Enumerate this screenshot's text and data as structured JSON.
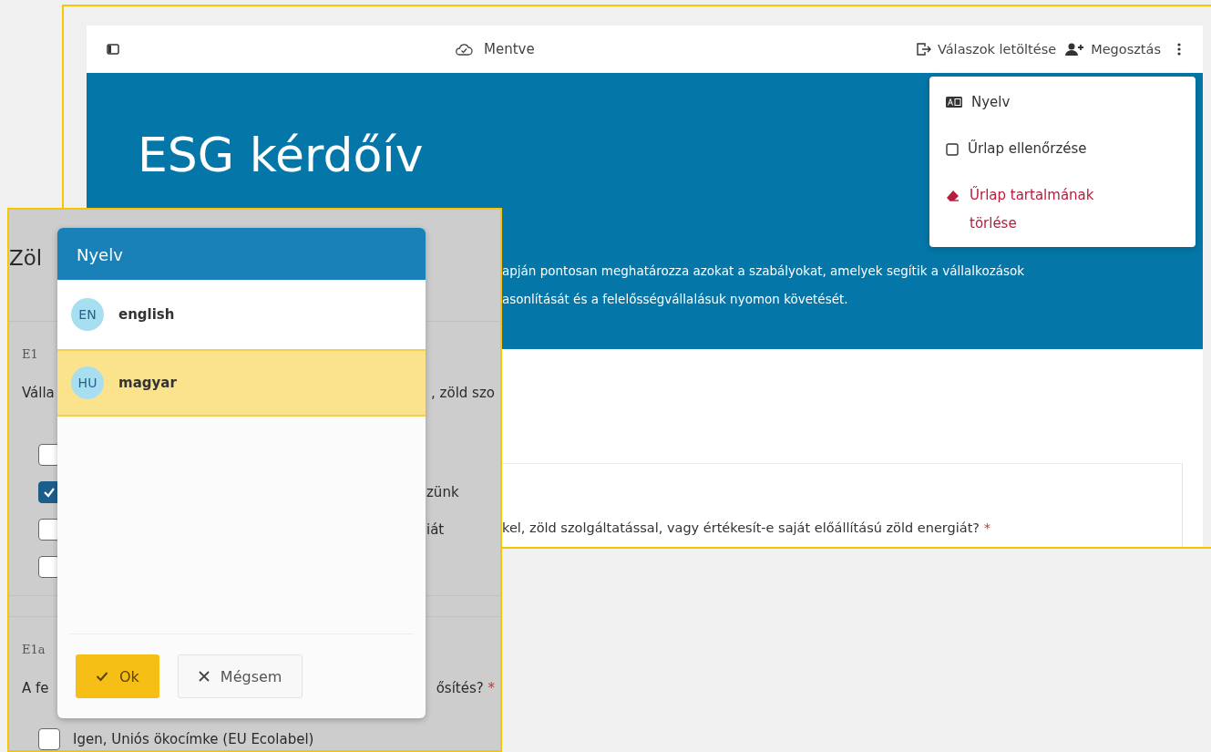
{
  "top_bar": {
    "saved_status": "Mentve",
    "download_button": "Válaszok letöltése",
    "share_button": "Megosztás"
  },
  "header": {
    "title": "ESG kérdőív",
    "description_lines": [
      "apján pontosan meghatározza azokat a szabályokat, amelyek segítik a vállalkozások",
      "asonlítását és a felelősségvállalásuk nyomon követését."
    ]
  },
  "menu": {
    "items": [
      {
        "kind": "language",
        "label": "Nyelv"
      },
      {
        "kind": "validate",
        "label": "Űrlap ellenőrzése"
      },
      {
        "kind": "clear",
        "label": "Űrlap tartalmának törlése"
      }
    ]
  },
  "question": {
    "text": "kel, zöld szolgáltatással, vagy értékesít-e saját előállítású zöld energiát?",
    "required_mark": "*"
  },
  "background_form": {
    "heading": "Zöl",
    "questions": [
      {
        "code": "E1",
        "text_start": "Válla",
        "text_end": ", zöld szo",
        "options": [
          {
            "checked": false
          },
          {
            "checked": true,
            "text": "zünk"
          },
          {
            "checked": false,
            "text": "iát"
          },
          {
            "checked": false
          }
        ]
      },
      {
        "code": "E1a",
        "text_start": "A fe",
        "text_end": "ősítés?",
        "required_mark": "*",
        "options": [
          {
            "checked": false,
            "text": "Igen, Uniós ökocímke (EU Ecolabel)"
          }
        ]
      }
    ]
  },
  "language_dialog": {
    "title": "Nyelv",
    "languages": [
      {
        "code": "EN",
        "name": "english",
        "selected": false
      },
      {
        "code": "HU",
        "name": "magyar",
        "selected": true
      }
    ],
    "buttons": [
      {
        "kind": "confirm",
        "label": "Ok"
      },
      {
        "kind": "cancel",
        "label": "Mégsem"
      }
    ]
  }
}
